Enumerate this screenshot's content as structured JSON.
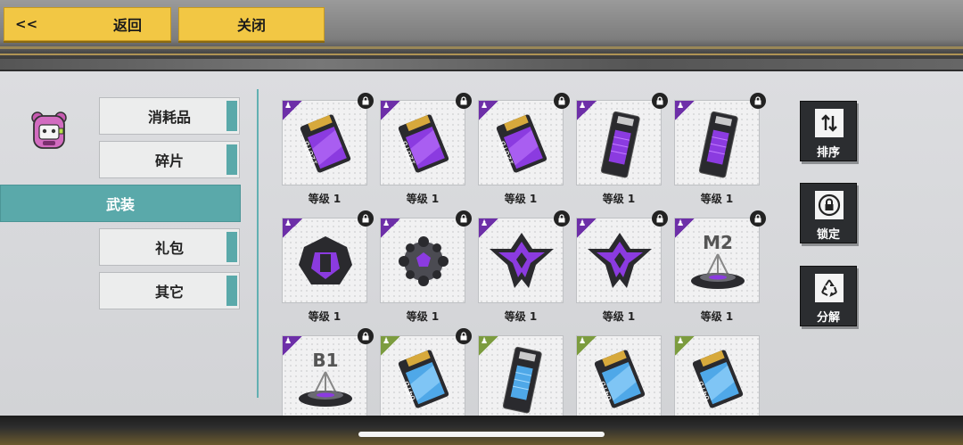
{
  "topbar": {
    "back_arrows": "<<",
    "back_label": "返回",
    "close_label": "关闭"
  },
  "categories": [
    {
      "label": "消耗品",
      "active": false
    },
    {
      "label": "碎片",
      "active": false
    },
    {
      "label": "武装",
      "active": true
    },
    {
      "label": "礼包",
      "active": false
    },
    {
      "label": "其它",
      "active": false
    }
  ],
  "items": [
    {
      "art": "storage-card-128tb-purple-icon",
      "rarity": "purple",
      "locked": true,
      "level": "等级 1",
      "card_text": "128TB"
    },
    {
      "art": "storage-card-128tb-purple-icon",
      "rarity": "purple",
      "locked": true,
      "level": "等级 1",
      "card_text": "128TB"
    },
    {
      "art": "storage-card-128tb-purple-icon",
      "rarity": "purple",
      "locked": true,
      "level": "等级 1",
      "card_text": "128TB"
    },
    {
      "art": "battery-purple-icon",
      "rarity": "purple",
      "locked": true,
      "level": "等级 1"
    },
    {
      "art": "battery-purple-icon",
      "rarity": "purple",
      "locked": true,
      "level": "等级 1"
    },
    {
      "art": "armor-chest-purple-icon",
      "rarity": "purple",
      "locked": true,
      "level": "等级 1"
    },
    {
      "art": "spiked-sphere-purple-icon",
      "rarity": "purple",
      "locked": true,
      "level": "等级 1"
    },
    {
      "art": "winged-emblem-purple-icon",
      "rarity": "purple",
      "locked": true,
      "level": "等级 1"
    },
    {
      "art": "winged-emblem-purple-icon",
      "rarity": "purple",
      "locked": true,
      "level": "等级 1"
    },
    {
      "art": "platform-m2-icon",
      "rarity": "purple",
      "locked": true,
      "level": "等级 1",
      "card_text": "M2"
    },
    {
      "art": "platform-b1-icon",
      "rarity": "purple",
      "locked": true,
      "level": "",
      "card_text": "B1"
    },
    {
      "art": "storage-card-64tb-blue-icon",
      "rarity": "green",
      "locked": true,
      "level": "",
      "card_text": "64TB"
    },
    {
      "art": "battery-blue-icon",
      "rarity": "green",
      "locked": false,
      "level": ""
    },
    {
      "art": "storage-card-64tb-blue-icon",
      "rarity": "green",
      "locked": false,
      "level": "",
      "card_text": "64TB"
    },
    {
      "art": "storage-card-64tb-blue-icon",
      "rarity": "green",
      "locked": false,
      "level": "",
      "card_text": "64TB"
    }
  ],
  "actions": [
    {
      "label": "排序",
      "icon": "sort-arrows-icon"
    },
    {
      "label": "锁定",
      "icon": "lock-icon"
    },
    {
      "label": "分解",
      "icon": "recycle-icon"
    }
  ],
  "colors": {
    "accent_teal": "#5aa9aa",
    "button_yellow": "#f2c744",
    "rarity_purple": "#6d2fa8",
    "rarity_green": "#7c9c3f",
    "action_dark": "#2b2d30"
  }
}
